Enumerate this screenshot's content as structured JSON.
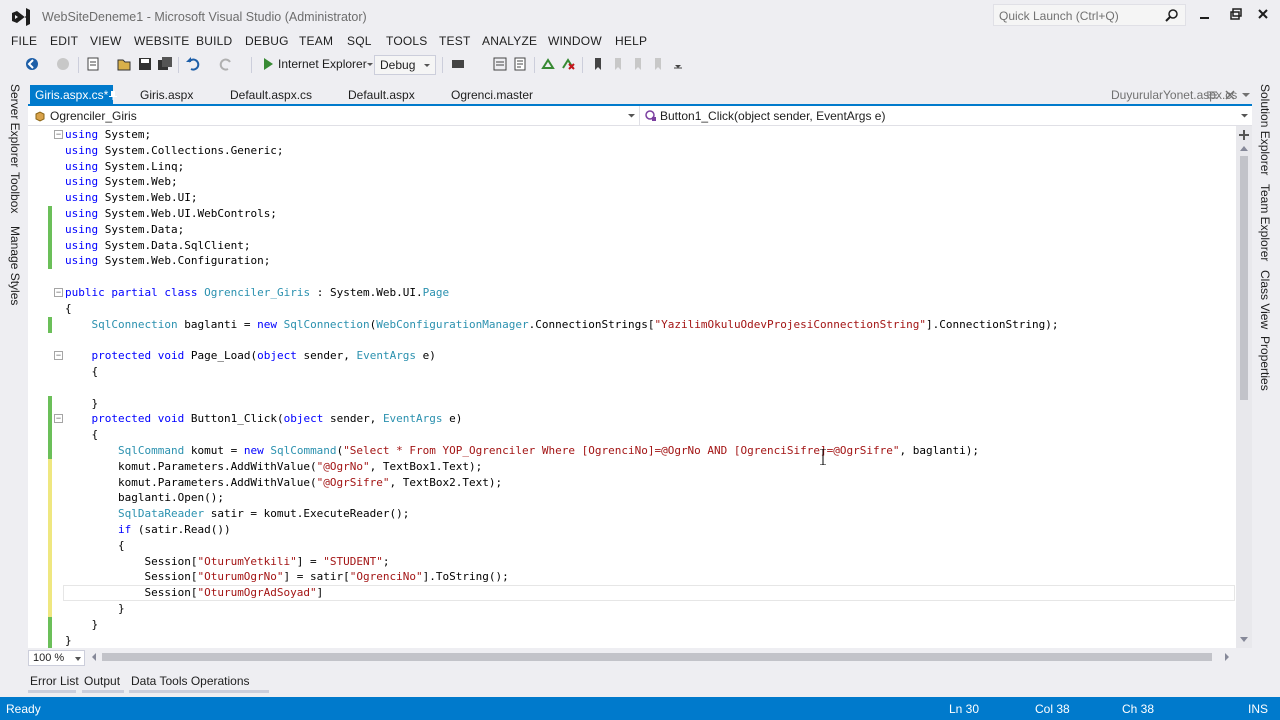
{
  "window": {
    "title": "WebSiteDeneme1 - Microsoft Visual Studio (Administrator)",
    "quick_launch_placeholder": "Quick Launch (Ctrl+Q)"
  },
  "menu": [
    "FILE",
    "EDIT",
    "VIEW",
    "WEBSITE",
    "BUILD",
    "DEBUG",
    "TEAM",
    "SQL",
    "TOOLS",
    "TEST",
    "ANALYZE",
    "WINDOW",
    "HELP"
  ],
  "toolbar": {
    "run_target": "Internet Explorer",
    "configuration": "Debug"
  },
  "left_dock": [
    "Server Explorer",
    "Toolbox",
    "Manage Styles"
  ],
  "right_dock": [
    "Solution Explorer",
    "Team Explorer",
    "Class View",
    "Properties"
  ],
  "tabs": [
    "Giris.aspx.cs*",
    "Giris.aspx",
    "Default.aspx.cs",
    "Default.aspx",
    "Ogrenci.master"
  ],
  "pinned_tab": "DuyurularYonet.aspx.cs",
  "navbar": {
    "type": "Ogrenciler_Giris",
    "member": "Button1_Click(object sender, EventArgs e)"
  },
  "code_lines": [
    {
      "text": "using System;",
      "marker": ""
    },
    {
      "text": "using System.Collections.Generic;",
      "marker": ""
    },
    {
      "text": "using System.Linq;",
      "marker": ""
    },
    {
      "text": "using System.Web;",
      "marker": ""
    },
    {
      "text": "using System.Web.UI;",
      "marker": ""
    },
    {
      "text": "using System.Web.UI.WebControls;",
      "marker": "green"
    },
    {
      "text": "using System.Data;",
      "marker": "green"
    },
    {
      "text": "using System.Data.SqlClient;",
      "marker": "green"
    },
    {
      "text": "using System.Web.Configuration;",
      "marker": "green"
    },
    {
      "text": "",
      "marker": ""
    },
    {
      "text": "public partial class Ogrenciler_Giris : System.Web.UI.Page",
      "marker": ""
    },
    {
      "text": "{",
      "marker": ""
    },
    {
      "text": "    SqlConnection baglanti = new SqlConnection(WebConfigurationManager.ConnectionStrings[\"YazilimOkuluOdevProjesiConnectionString\"].ConnectionString);",
      "marker": "green"
    },
    {
      "text": "",
      "marker": ""
    },
    {
      "text": "    protected void Page_Load(object sender, EventArgs e)",
      "marker": ""
    },
    {
      "text": "    {",
      "marker": ""
    },
    {
      "text": "",
      "marker": ""
    },
    {
      "text": "    }",
      "marker": "green"
    },
    {
      "text": "    protected void Button1_Click(object sender, EventArgs e)",
      "marker": "green"
    },
    {
      "text": "    {",
      "marker": "green"
    },
    {
      "text": "        SqlCommand komut = new SqlCommand(\"Select * From YOP_Ogrenciler Where [OgrenciNo]=@OgrNo AND [OgrenciSifre]=@OgrSifre\", baglanti);",
      "marker": "green"
    },
    {
      "text": "        komut.Parameters.AddWithValue(\"@OgrNo\", TextBox1.Text);",
      "marker": "yellow"
    },
    {
      "text": "        komut.Parameters.AddWithValue(\"@OgrSifre\", TextBox2.Text);",
      "marker": "yellow"
    },
    {
      "text": "        baglanti.Open();",
      "marker": "yellow"
    },
    {
      "text": "        SqlDataReader satir = komut.ExecuteReader();",
      "marker": "yellow"
    },
    {
      "text": "        if (satir.Read())",
      "marker": "yellow"
    },
    {
      "text": "        {",
      "marker": "yellow"
    },
    {
      "text": "            Session[\"OturumYetkili\"] = \"STUDENT\";",
      "marker": "yellow"
    },
    {
      "text": "            Session[\"OturumOgrNo\"] = satir[\"OgrenciNo\"].ToString();",
      "marker": "yellow"
    },
    {
      "text": "            Session[\"OturumOgrAdSoyad\"]",
      "marker": "yellow"
    },
    {
      "text": "        }",
      "marker": "yellow"
    },
    {
      "text": "    }",
      "marker": "green"
    },
    {
      "text": "}",
      "marker": "green"
    }
  ],
  "zoom": "100 %",
  "panel_tabs": [
    "Error List",
    "Output",
    "Data Tools Operations"
  ],
  "status": {
    "state": "Ready",
    "line": "Ln 30",
    "col": "Col 38",
    "ch": "Ch 38",
    "mode": "INS"
  },
  "colors": {
    "accent": "#007acc",
    "keyword": "#0000ff",
    "type": "#2b91af",
    "string": "#a31515",
    "saved_change": "#6bbf59",
    "unsaved_change": "#efe780"
  }
}
